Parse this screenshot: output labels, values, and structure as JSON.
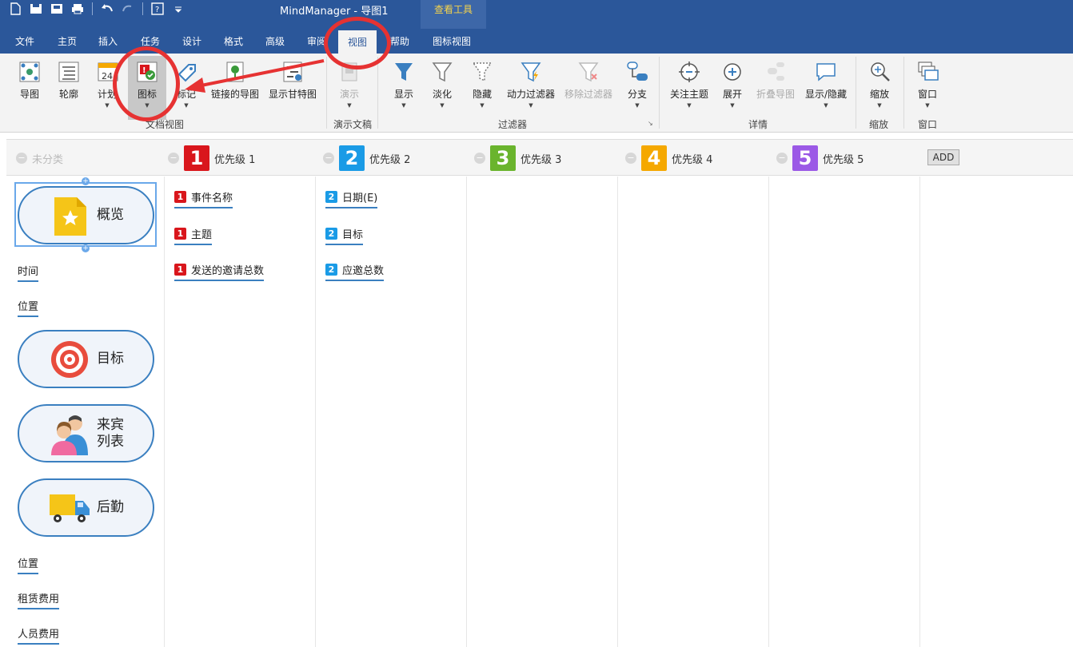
{
  "app_title": "MindManager - 导图1",
  "context_tab_title": "查看工具",
  "tabs": [
    "文件",
    "主页",
    "插入",
    "任务",
    "设计",
    "格式",
    "高级",
    "审阅",
    "视图",
    "帮助",
    "图标视图"
  ],
  "active_tab": "视图",
  "ribbon": {
    "doc_view": {
      "label": "文档视图",
      "buttons": [
        "导图",
        "轮廓",
        "计划",
        "图标",
        "标记",
        "链接的导图",
        "显示甘特图"
      ]
    },
    "presentation": {
      "label": "演示文稿",
      "buttons": [
        "演示"
      ]
    },
    "filter": {
      "label": "过滤器",
      "buttons": [
        "显示",
        "淡化",
        "隐藏",
        "动力过滤器",
        "移除过滤器",
        "分支"
      ]
    },
    "detail": {
      "label": "详情",
      "buttons": [
        "关注主题",
        "展开",
        "折叠导图",
        "显示/隐藏"
      ]
    },
    "zoom": {
      "label": "缩放",
      "buttons": [
        "缩放"
      ]
    },
    "window": {
      "label": "窗口",
      "buttons": [
        "窗口"
      ]
    }
  },
  "priority_header": {
    "uncategorized": "未分类",
    "priorities": [
      {
        "num": "1",
        "label": "优先级 1",
        "color": "#d9161c"
      },
      {
        "num": "2",
        "label": "优先级 2",
        "color": "#1a9be6"
      },
      {
        "num": "3",
        "label": "优先级 3",
        "color": "#6ab42d"
      },
      {
        "num": "4",
        "label": "优先级 4",
        "color": "#f5a800"
      },
      {
        "num": "5",
        "label": "优先级 5",
        "color": "#9b59e6"
      }
    ],
    "add_label": "ADD"
  },
  "uncategorized_topics": {
    "overview": "概览",
    "time": "时间",
    "location1": "位置",
    "goal": "目标",
    "guests_line1": "来宾",
    "guests_line2": "列表",
    "logistics": "后勤",
    "location2": "位置",
    "rental": "租赁费用",
    "staff": "人员费用"
  },
  "priority1_topics": [
    "事件名称",
    "主题",
    "发送的邀请总数"
  ],
  "priority2_topics": [
    "日期(E)",
    "目标",
    "应邀总数"
  ]
}
